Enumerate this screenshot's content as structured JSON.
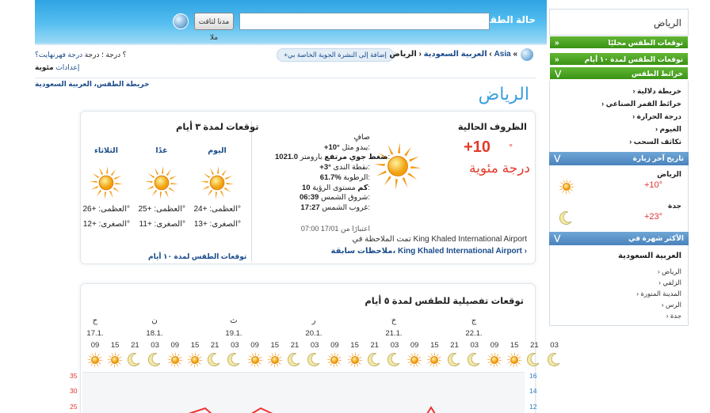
{
  "header": {
    "search_title": "حالة الطقس لـ",
    "search_placeholder": "",
    "search_button": "مدنا لتاقت ملا"
  },
  "top_left": {
    "units_prefix": "؛ درجة",
    "units_current": "؟ درجة",
    "units_fahrenheit": "درجة فهرنهايت؟",
    "settings_label": "إعدادات",
    "settings_value": "مئوية",
    "map_link": "خريطة الطقس، العربية السعودية"
  },
  "breadcrumb": {
    "add_gadget": "+إضافة إلى النشرة الجوية الخاصة بي",
    "country": "العربية السعودية",
    "city": "الرياض",
    "region": "Asia"
  },
  "city_title": "الرياض",
  "current": {
    "title": "الظروف الحالية",
    "temp": "+10",
    "temp_deg": "°",
    "unit": "درجة مئوية",
    "icon": "sun-icon",
    "details": [
      {
        "label": "صافٍ",
        "value": ""
      },
      {
        "label": "يبدو مثل:",
        "value": "+10°"
      },
      {
        "label": "بارومتر:",
        "value": "1021.0 ضغط جوي مرتفع"
      },
      {
        "label": "نقطة الندى:",
        "value": "+3°"
      },
      {
        "label": "الرطوبة:",
        "value": "61.7%"
      },
      {
        "label": "مستوى الرؤية:",
        "value": "10 كم"
      },
      {
        "label": "شروق الشمس:",
        "value": "06:39"
      },
      {
        "label": "غروب الشمس:",
        "value": "17:27"
      }
    ],
    "as_of": "اعتبارًا من 17/01 07:00",
    "station_label": "تمت الملاحظة في King Khaled International Airport",
    "station_link": "ملاحظات سابقة، King Khaled International Airport ›"
  },
  "forecast3": {
    "title": "توقعات لمدة ٣ أيام",
    "link": "توقعات الطقس لمدة ١٠ أيام",
    "days": [
      {
        "label": "اليوم",
        "max": "العظمى: +24°",
        "min": "الصغرى: +13°"
      },
      {
        "label": "غدًا",
        "max": "العظمى: +25°",
        "min": "الصغرى: +11°"
      },
      {
        "label": "الثلاثاء",
        "max": "العظمى: +26°",
        "min": "الصغرى: +12°"
      }
    ]
  },
  "forecast5": {
    "title": "توقعات تفصيلية للطقس لمدة ٥ أيام",
    "days": [
      {
        "letter": "ح",
        "date": "17.1."
      },
      {
        "letter": "ن",
        "date": "18.1."
      },
      {
        "letter": "ث",
        "date": "19.1."
      },
      {
        "letter": "ر",
        "date": "20.1."
      },
      {
        "letter": "خ",
        "date": "21.1."
      },
      {
        "letter": "ج",
        "date": "22.1."
      }
    ],
    "hours": [
      "09",
      "15",
      "21",
      "03",
      "09",
      "15",
      "21",
      "03",
      "09",
      "15",
      "21",
      "03",
      "09",
      "15",
      "21",
      "03",
      "09",
      "15",
      "21",
      "03",
      "09",
      "15",
      "21",
      "03"
    ],
    "icons": [
      "sun",
      "sun",
      "moon",
      "moon",
      "sun",
      "sun",
      "moon",
      "moon",
      "sun",
      "sun",
      "moon",
      "moon",
      "sun",
      "sun",
      "moon",
      "moon",
      "sun",
      "sun",
      "moon",
      "moon",
      "sun",
      "sun",
      "moon",
      "moon"
    ],
    "y_left": [
      "35",
      "30",
      "25"
    ],
    "y_right": [
      "16",
      "14",
      "12"
    ]
  },
  "sidebar": {
    "city": "الرياض",
    "local_forecast": "توقعات الطقس محليًا",
    "ten_day": "توقعات الطقس لمدة ١٠ أيام",
    "maps_header": "خرائط الطقس",
    "maps": [
      "› خريطة دلالية",
      "› خرائط القمر الصناعي",
      "› درجة الحرارة",
      "› الغيوم",
      "› تكاثف السحب"
    ],
    "history_header": "تاريخ آخر زيارة",
    "history": [
      {
        "city": "الرياض",
        "temp": "+10°",
        "icon": "sun-icon"
      },
      {
        "city": "جدة",
        "temp": "+23°",
        "icon": "moon-icon"
      }
    ],
    "popular_header": "الأكثر شهرة في",
    "popular_country": "العربية السعودية",
    "popular_cities": [
      "› الرياض",
      "› الزلفي",
      "› المدينة المنورة",
      "› الرس",
      "› جدة"
    ]
  },
  "colors": {
    "temp_red": "#e23b2b",
    "link_blue": "#1a4c8b",
    "sidebar_green": "#4ca222",
    "sidebar_blue": "#5a92c8"
  }
}
